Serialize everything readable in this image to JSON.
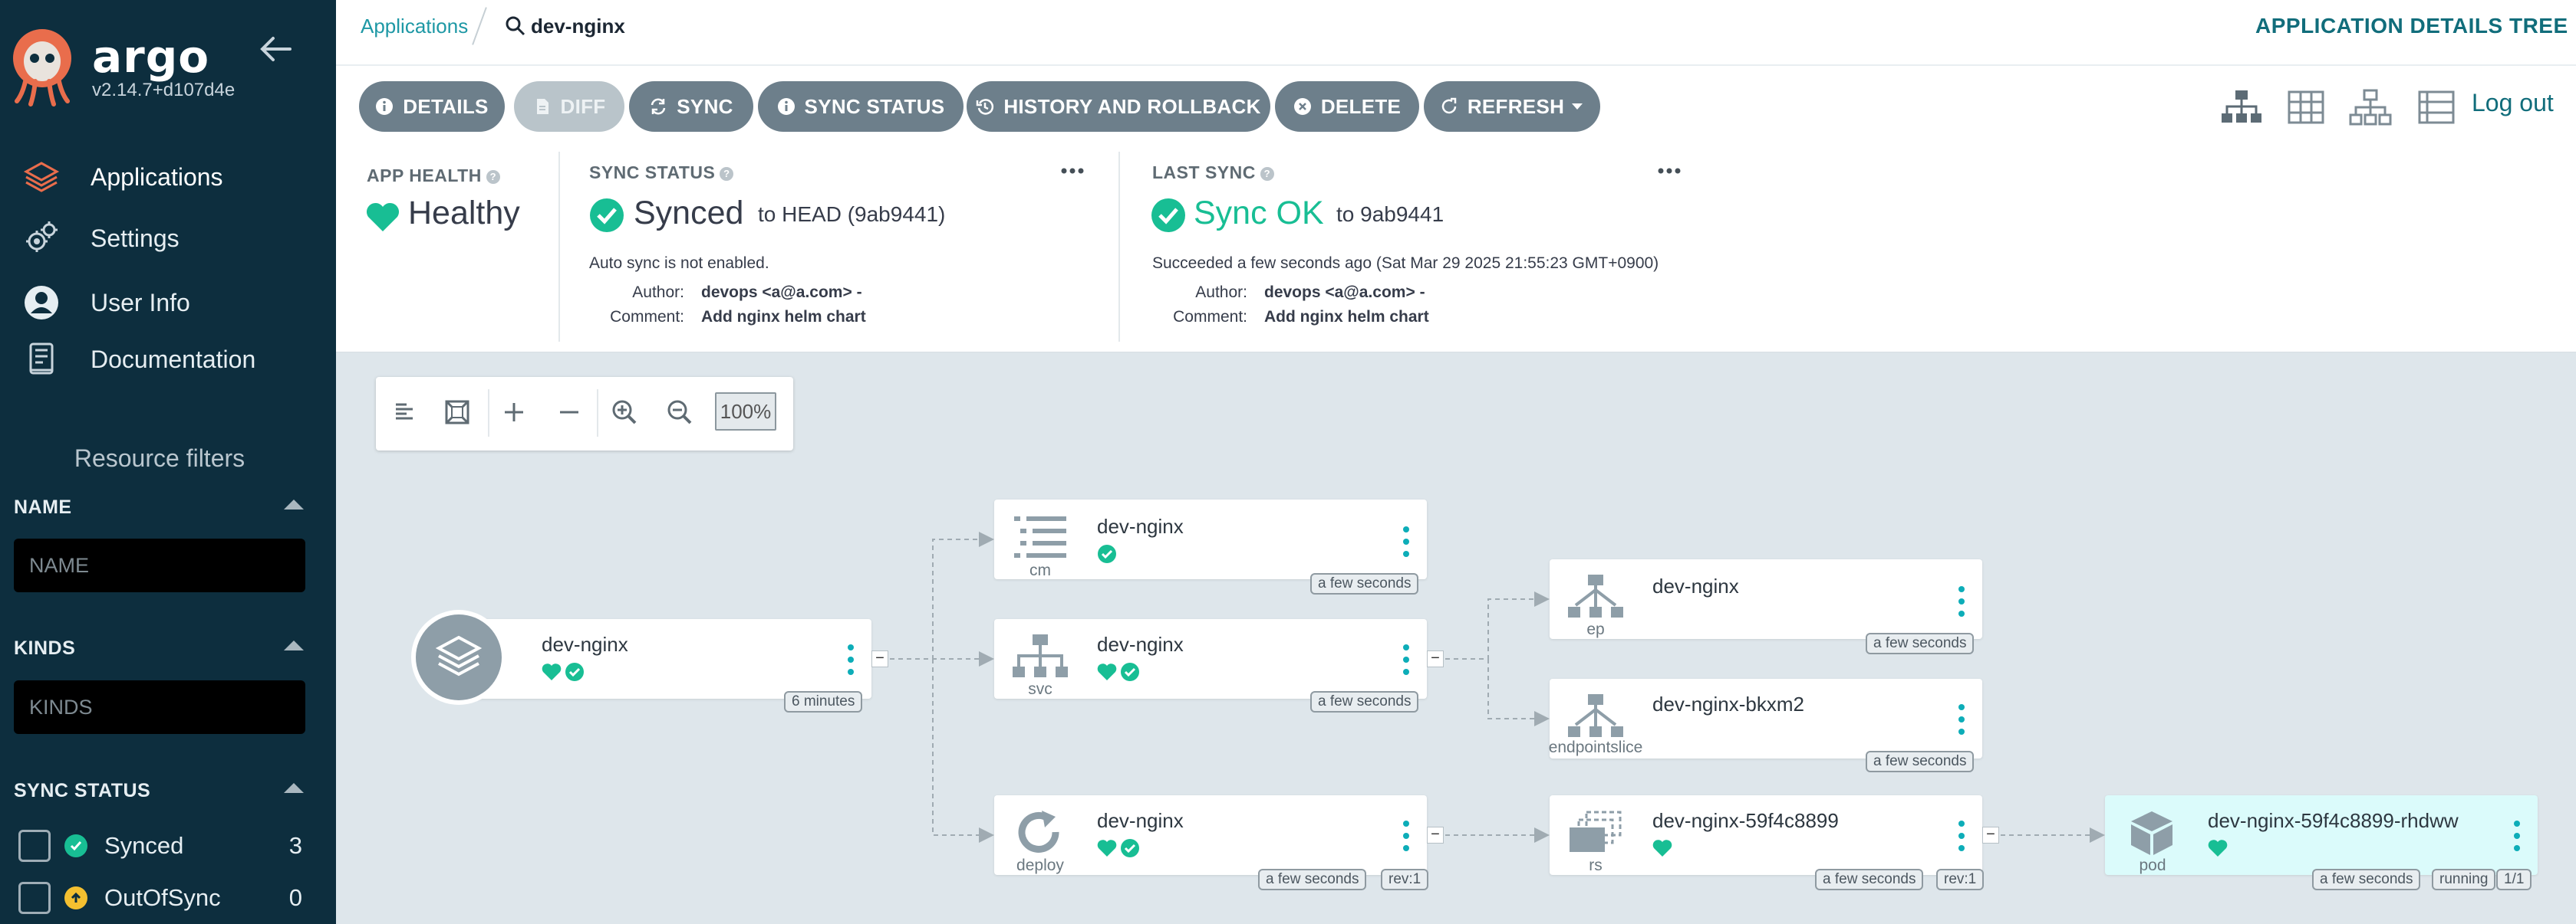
{
  "sidebar": {
    "brand": "argo",
    "version": "v2.14.7+d107d4e",
    "nav": [
      {
        "label": "Applications",
        "icon": "layers-icon"
      },
      {
        "label": "Settings",
        "icon": "gears-icon"
      },
      {
        "label": "User Info",
        "icon": "user-circle-icon"
      },
      {
        "label": "Documentation",
        "icon": "book-icon"
      }
    ],
    "resource_filters_title": "Resource filters",
    "filters": {
      "name_label": "NAME",
      "name_placeholder": "NAME",
      "kinds_label": "KINDS",
      "kinds_placeholder": "KINDS",
      "sync_status_label": "SYNC STATUS",
      "sync_items": [
        {
          "label": "Synced",
          "count": "3",
          "color": "#18be94"
        },
        {
          "label": "OutOfSync",
          "count": "0",
          "color": "#f4c030"
        }
      ]
    }
  },
  "breadcrumb": {
    "parent": "Applications",
    "current": "dev-nginx"
  },
  "page_title": "APPLICATION DETAILS TREE",
  "toolbar": {
    "buttons": [
      {
        "label": "DETAILS",
        "icon": "info-icon"
      },
      {
        "label": "DIFF",
        "icon": "file-icon",
        "disabled": true
      },
      {
        "label": "SYNC",
        "icon": "sync-icon"
      },
      {
        "label": "SYNC STATUS",
        "icon": "info-icon"
      },
      {
        "label": "HISTORY AND ROLLBACK",
        "icon": "history-icon"
      },
      {
        "label": "DELETE",
        "icon": "times-circle-icon"
      },
      {
        "label": "REFRESH",
        "icon": "refresh-icon"
      }
    ],
    "logout": "Log out"
  },
  "summary": {
    "app_health": {
      "label": "APP HEALTH",
      "value": "Healthy"
    },
    "sync_status": {
      "label": "SYNC STATUS",
      "value": "Synced",
      "to": "to HEAD (9ab9441)",
      "auto_sync": "Auto sync is not enabled.",
      "author_label": "Author:",
      "author": "devops <a@a.com> -",
      "comment_label": "Comment:",
      "comment": "Add nginx helm chart"
    },
    "last_sync": {
      "label": "LAST SYNC",
      "value": "Sync OK",
      "to": "to 9ab9441",
      "detail": "Succeeded a few seconds ago (Sat Mar 29 2025 21:55:23 GMT+0900)",
      "author_label": "Author:",
      "author": "devops <a@a.com> -",
      "comment_label": "Comment:",
      "comment": "Add nginx helm chart"
    }
  },
  "graph": {
    "zoom": "100%",
    "nodes": {
      "app": {
        "name": "dev-nginx",
        "age": "6 minutes"
      },
      "cm": {
        "name": "dev-nginx",
        "kind": "cm",
        "age": "a few seconds"
      },
      "svc": {
        "name": "dev-nginx",
        "kind": "svc",
        "age": "a few seconds"
      },
      "deploy": {
        "name": "dev-nginx",
        "kind": "deploy",
        "age": "a few seconds",
        "rev": "rev:1"
      },
      "ep": {
        "name": "dev-nginx",
        "kind": "ep",
        "age": "a few seconds"
      },
      "eps": {
        "name": "dev-nginx-bkxm2",
        "kind": "endpointslice",
        "age": "a few seconds"
      },
      "rs": {
        "name": "dev-nginx-59f4c8899",
        "kind": "rs",
        "age": "a few seconds",
        "rev": "rev:1"
      },
      "pod": {
        "name": "dev-nginx-59f4c8899-rhdww",
        "kind": "pod",
        "age": "a few seconds",
        "status": "running",
        "ready": "1/1"
      }
    }
  },
  "colors": {
    "teal": "#18be94",
    "sidebar": "#0d2e3e",
    "button": "#6d7f8b",
    "accent": "#116d7b"
  }
}
